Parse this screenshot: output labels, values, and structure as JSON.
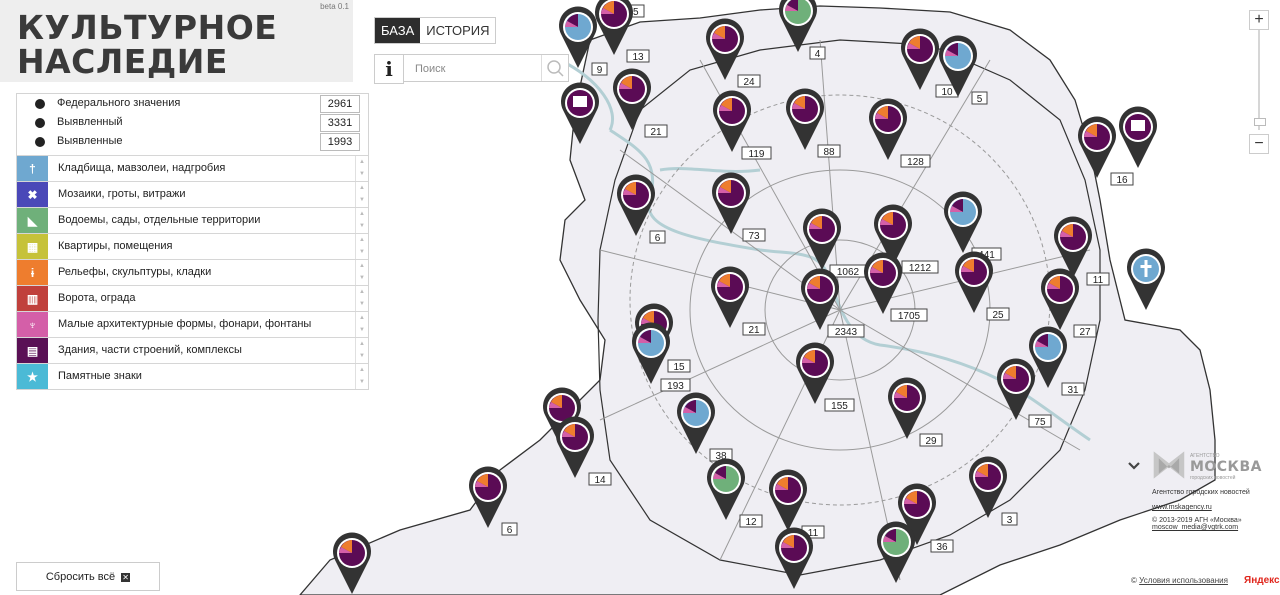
{
  "app": {
    "title_line1": "КУЛЬТУРНОЕ",
    "title_line2": "НАСЛЕДИЕ",
    "beta": "beta 0.1"
  },
  "tabs": [
    {
      "label": "БАЗА",
      "active": true
    },
    {
      "label": "ИСТОРИЯ",
      "active": false
    }
  ],
  "info_icon": "i",
  "search": {
    "placeholder": "Поиск",
    "icon": "search-icon"
  },
  "significance": [
    {
      "label": "Федерального значения",
      "count": "2961"
    },
    {
      "label": "Выявленный",
      "count": "3331"
    },
    {
      "label": "Выявленные",
      "count": "1993"
    }
  ],
  "categories": [
    {
      "label": "Кладбища, мавзолеи, надгробия",
      "color": "#6fa8d0",
      "icon": "cross-icon",
      "glyph": "†"
    },
    {
      "label": "Мозаики, гроты, витражи",
      "color": "#4a48b8",
      "icon": "mosaic-icon",
      "glyph": "✖"
    },
    {
      "label": "Водоемы, сады, отдельные территории",
      "color": "#6fb07a",
      "icon": "leaf-icon",
      "glyph": "◣"
    },
    {
      "label": "Квартиры, помещения",
      "color": "#c6c23a",
      "icon": "apartment-icon",
      "glyph": "▦"
    },
    {
      "label": "Рельефы, скульптуры, кладки",
      "color": "#ee7d2e",
      "icon": "sculpture-icon",
      "glyph": "ɨ"
    },
    {
      "label": "Ворота, ограда",
      "color": "#c0403c",
      "icon": "gate-icon",
      "glyph": "▥"
    },
    {
      "label": "Малые архитектурные формы, фонари, фонтаны",
      "color": "#d45fa8",
      "icon": "lantern-icon",
      "glyph": "♆"
    },
    {
      "label": "Здания, части строений, комплексы",
      "color": "#5a1055",
      "icon": "building-icon",
      "glyph": "▤"
    },
    {
      "label": "Памятные знаки",
      "color": "#4bbad6",
      "icon": "star-icon",
      "glyph": "★"
    }
  ],
  "reset": {
    "label": "Сбросить всё"
  },
  "zoom": {
    "in": "+",
    "out": "−"
  },
  "agency": {
    "brand": "МОСКВА",
    "brand_top": "АГЕНТСТВО",
    "brand_sub": "городских новостей",
    "name": "Агентство городских новостей",
    "site": "www.mskagency.ru",
    "copyright": "© 2013-2019 АГН «Москва»",
    "email": "moscow_media@vgtrk.com"
  },
  "footer": {
    "terms_prefix": "©",
    "terms": "Условия использования",
    "provider": "Яндекс"
  },
  "colors": {
    "purple": "#5b0b55",
    "blue": "#6fa8d0",
    "green": "#6fb07a",
    "orange": "#ee7d2e",
    "pink": "#d45fa8",
    "pin": "#333333",
    "map_land": "#f0eff4",
    "river": "#b3cfd4",
    "road": "#8a8a8a"
  },
  "markers": [
    {
      "label": "25",
      "theme": "p"
    },
    {
      "label": "13",
      "theme": "p"
    },
    {
      "label": "9",
      "theme": "b"
    },
    {
      "label": "4",
      "theme": "g"
    },
    {
      "label": "24",
      "theme": "p"
    },
    {
      "label": "10",
      "theme": "p"
    },
    {
      "label": "5",
      "theme": "b"
    },
    {
      "label": "",
      "theme": "building"
    },
    {
      "label": "21",
      "theme": "p"
    },
    {
      "label": "119",
      "theme": "p"
    },
    {
      "label": "88",
      "theme": "p"
    },
    {
      "label": "128",
      "theme": "p"
    },
    {
      "label": "16",
      "theme": "p"
    },
    {
      "label": "",
      "theme": "building"
    },
    {
      "label": "6",
      "theme": "p"
    },
    {
      "label": "73",
      "theme": "p"
    },
    {
      "label": "441",
      "theme": "b"
    },
    {
      "label": "1062",
      "theme": "p"
    },
    {
      "label": "1212",
      "theme": "p"
    },
    {
      "label": "11",
      "theme": "p"
    },
    {
      "label": "",
      "theme": "cross"
    },
    {
      "label": "1705",
      "theme": "p"
    },
    {
      "label": "25",
      "theme": "p"
    },
    {
      "label": "21",
      "theme": "p"
    },
    {
      "label": "2343",
      "theme": "p"
    },
    {
      "label": "27",
      "theme": "p"
    },
    {
      "label": "15",
      "theme": "p"
    },
    {
      "label": "193",
      "theme": "b"
    },
    {
      "label": "155",
      "theme": "p"
    },
    {
      "label": "31",
      "theme": "b"
    },
    {
      "label": "75",
      "theme": "p"
    },
    {
      "label": "29",
      "theme": "p"
    },
    {
      "label": "",
      "theme": "p"
    },
    {
      "label": "38",
      "theme": "b"
    },
    {
      "label": "14",
      "theme": "p"
    },
    {
      "label": "6",
      "theme": "p"
    },
    {
      "label": "12",
      "theme": "g"
    },
    {
      "label": "11",
      "theme": "p"
    },
    {
      "label": "3",
      "theme": "p"
    },
    {
      "label": "36",
      "theme": "p"
    },
    {
      "label": "",
      "theme": "g"
    },
    {
      "label": "",
      "theme": "p"
    },
    {
      "label": "",
      "theme": "p"
    }
  ]
}
